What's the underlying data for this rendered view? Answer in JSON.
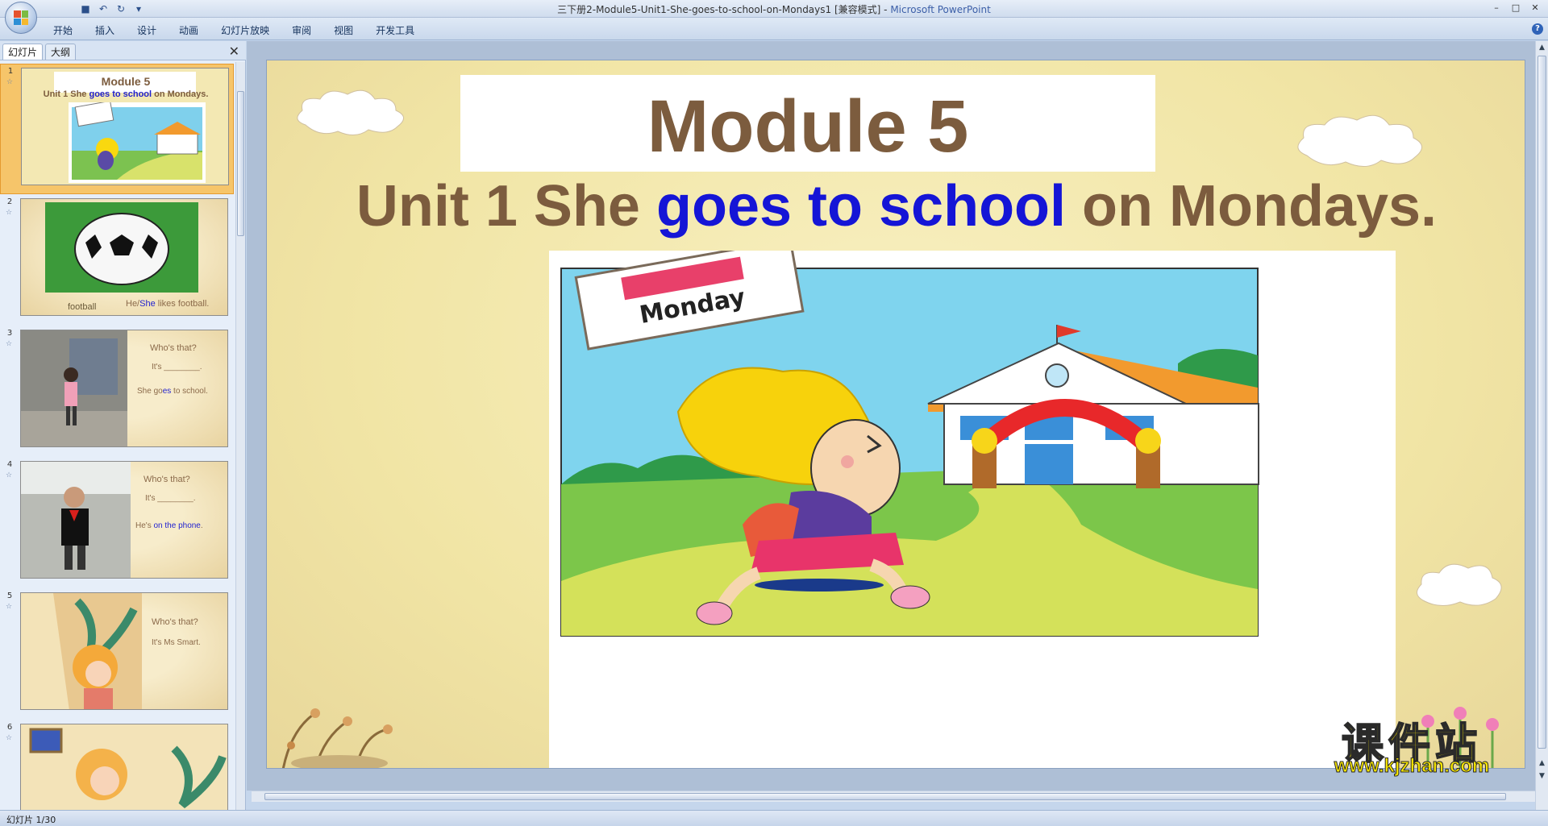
{
  "window": {
    "title_doc": "三下册2-Module5-Unit1-She-goes-to-school-on-Mondays1 [兼容模式] -",
    "title_app": "Microsoft PowerPoint",
    "controls": [
      "–",
      "□",
      "✕"
    ]
  },
  "qat": {
    "icons": [
      "save-icon",
      "undo-icon",
      "redo-icon",
      "customize-icon"
    ],
    "glyphs": [
      "■",
      "↶",
      "↻",
      "▾"
    ]
  },
  "ribbon": {
    "tabs": [
      "开始",
      "插入",
      "设计",
      "动画",
      "幻灯片放映",
      "审阅",
      "视图",
      "开发工具"
    ],
    "help": "?"
  },
  "pane": {
    "tab_slides": "幻灯片",
    "tab_outline": "大纲",
    "close": "✕"
  },
  "thumbnails": [
    {
      "num": "1",
      "star": "☆",
      "title": "Module 5",
      "sub_a": "Unit 1 She ",
      "sub_b": "goes to school",
      "sub_c": " on Mondays.",
      "label": "Monday"
    },
    {
      "num": "2",
      "star": "☆",
      "caption_left": "football",
      "cap_a": "He/",
      "cap_b": "She",
      "cap_c": " likes football."
    },
    {
      "num": "3",
      "star": "☆",
      "line1": "Who's that?",
      "line2": "It's ________.",
      "line3_a": "She go",
      "line3_b": "es",
      "line3_c": " to school."
    },
    {
      "num": "4",
      "star": "☆",
      "line1": "Who's that?",
      "line2": "It's ________.",
      "line3_a": "He's ",
      "line3_b": "on the phone",
      "line3_c": "."
    },
    {
      "num": "5",
      "star": "☆",
      "line1": "Who's that?",
      "line2": "It's Ms Smart."
    },
    {
      "num": "6",
      "star": "☆"
    }
  ],
  "slide": {
    "title": "Module 5",
    "subtitle_a": "Unit 1 She ",
    "subtitle_b": "goes to school",
    "subtitle_c": " on Mondays.",
    "calendar_label": "Monday"
  },
  "watermark": {
    "cn": "课件站",
    "url": "www.kjzhan.com"
  },
  "status": {
    "text": "幻灯片 1/30"
  },
  "colors": {
    "title_brown": "#7c5c3e",
    "highlight_blue": "#1515d6",
    "selected_thumb": "#f6c56a"
  }
}
